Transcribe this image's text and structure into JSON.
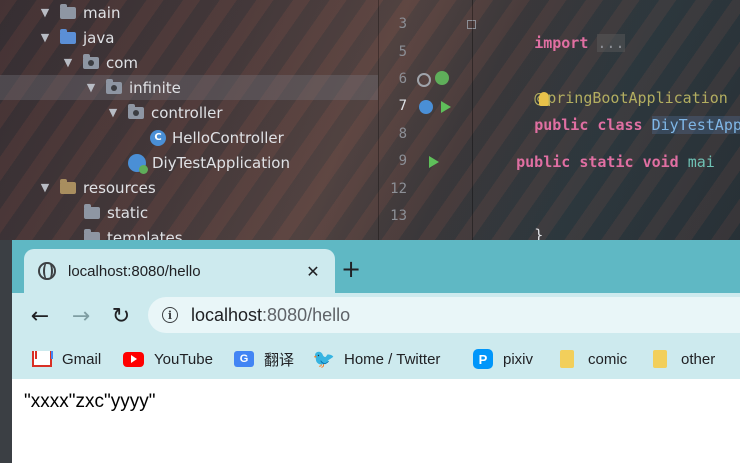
{
  "ide": {
    "tree": [
      {
        "label": "main",
        "kind": "folder",
        "indent": 0,
        "expanded": true
      },
      {
        "label": "java",
        "kind": "folder-blue",
        "indent": 1,
        "expanded": true
      },
      {
        "label": "com",
        "kind": "package",
        "indent": 2,
        "expanded": true
      },
      {
        "label": "infinite",
        "kind": "package",
        "indent": 3,
        "expanded": true,
        "selected": true
      },
      {
        "label": "controller",
        "kind": "package",
        "indent": 4,
        "expanded": true
      },
      {
        "label": "HelloController",
        "kind": "class",
        "indent": 5
      },
      {
        "label": "DiyTestApplication",
        "kind": "app",
        "indent": 4
      },
      {
        "label": "resources",
        "kind": "resources",
        "indent": 1,
        "expanded": true
      },
      {
        "label": "static",
        "kind": "folder",
        "indent": 2
      },
      {
        "label": "templates",
        "kind": "folder",
        "indent": 2
      }
    ],
    "line_numbers": [
      "3",
      "5",
      "6",
      "7",
      "8",
      "9",
      "12",
      "13"
    ],
    "code": {
      "import_kw": "import",
      "import_folded": "...",
      "annotation_at": "@",
      "annotation_rest": "pringBootApplication",
      "public_kw": "public",
      "class_kw": "class",
      "class_name": "DiyTestApplic",
      "static_kw": "static",
      "void_kw": "void",
      "method_name": "mai",
      "close_brace": "}"
    }
  },
  "browser": {
    "tab_title": "localhost:8080/hello",
    "tab_close": "✕",
    "new_tab": "+",
    "url_host": "localhost",
    "url_rest": ":8080/hello",
    "bookmarks": [
      {
        "label": "Gmail",
        "icon": "gmail-icon"
      },
      {
        "label": "YouTube",
        "icon": "youtube-icon"
      },
      {
        "label": "翻译",
        "icon": "google-translate-icon"
      },
      {
        "label": "Home / Twitter",
        "icon": "twitter-icon"
      },
      {
        "label": "pixiv",
        "icon": "pixiv-icon"
      },
      {
        "label": "comic",
        "icon": "folder-icon"
      },
      {
        "label": "other",
        "icon": "folder-icon"
      }
    ],
    "response_text": "\"xxxx\"zxc\"yyyy\""
  },
  "colors": {
    "browser_frame": "#5fb8c4",
    "toolbar_bg": "#cdeaee",
    "keyword": "#e06fa2",
    "annotation": "#b3ae60"
  }
}
